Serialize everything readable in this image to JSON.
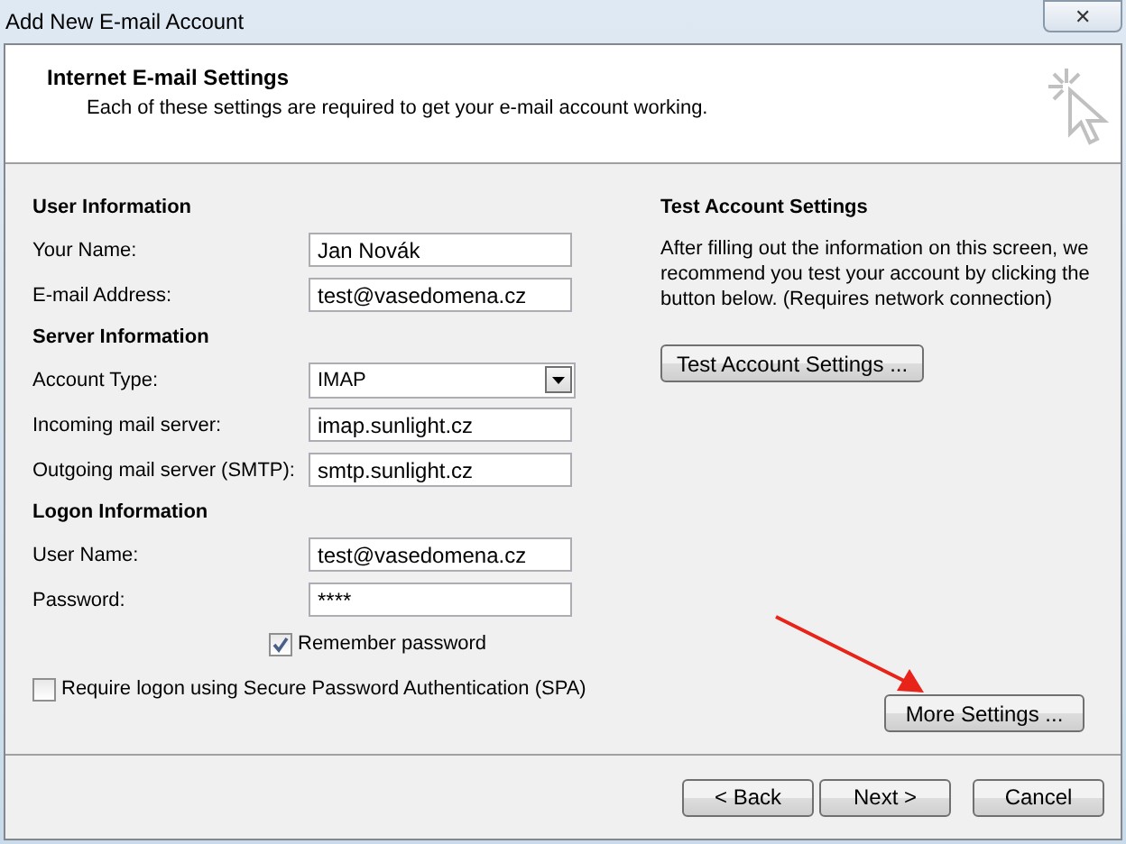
{
  "window": {
    "title": "Add New E-mail Account",
    "close": "✕"
  },
  "header": {
    "title": "Internet E-mail Settings",
    "subtitle": "Each of these settings are required to get your e-mail account working."
  },
  "sections": [
    {
      "title": "User Information",
      "fields": [
        {
          "kind": "text",
          "label": "Your Name:",
          "value": "Jan Novák"
        },
        {
          "kind": "text",
          "label": "E-mail Address:",
          "value": "test@vasedomena.cz"
        }
      ]
    },
    {
      "title": "Server Information",
      "fields": [
        {
          "kind": "dropdown",
          "label": "Account Type:",
          "value": "IMAP"
        },
        {
          "kind": "text",
          "label": "Incoming mail server:",
          "value": "imap.sunlight.cz"
        },
        {
          "kind": "text",
          "label": "Outgoing mail server (SMTP):",
          "value": "smtp.sunlight.cz"
        }
      ]
    },
    {
      "title": "Logon Information",
      "fields": [
        {
          "kind": "text",
          "label": "User Name:",
          "value": "test@vasedomena.cz"
        },
        {
          "kind": "password",
          "label": "Password:",
          "value": "****"
        }
      ]
    }
  ],
  "remember_password": {
    "label": "Remember password",
    "checked": true
  },
  "require_spa": {
    "label": "Require logon using Secure Password Authentication (SPA)",
    "checked": false
  },
  "test_settings": {
    "title": "Test Account Settings",
    "text": "After filling out the information on this screen, we recommend you test your account by clicking the button below. (Requires network connection)",
    "button": "Test Account Settings ..."
  },
  "more_settings_button": "More Settings ...",
  "buttons": [
    {
      "kind": "back",
      "label": "< Back"
    },
    {
      "kind": "next",
      "label": "Next >"
    },
    {
      "kind": "cancel",
      "label": "Cancel"
    }
  ]
}
